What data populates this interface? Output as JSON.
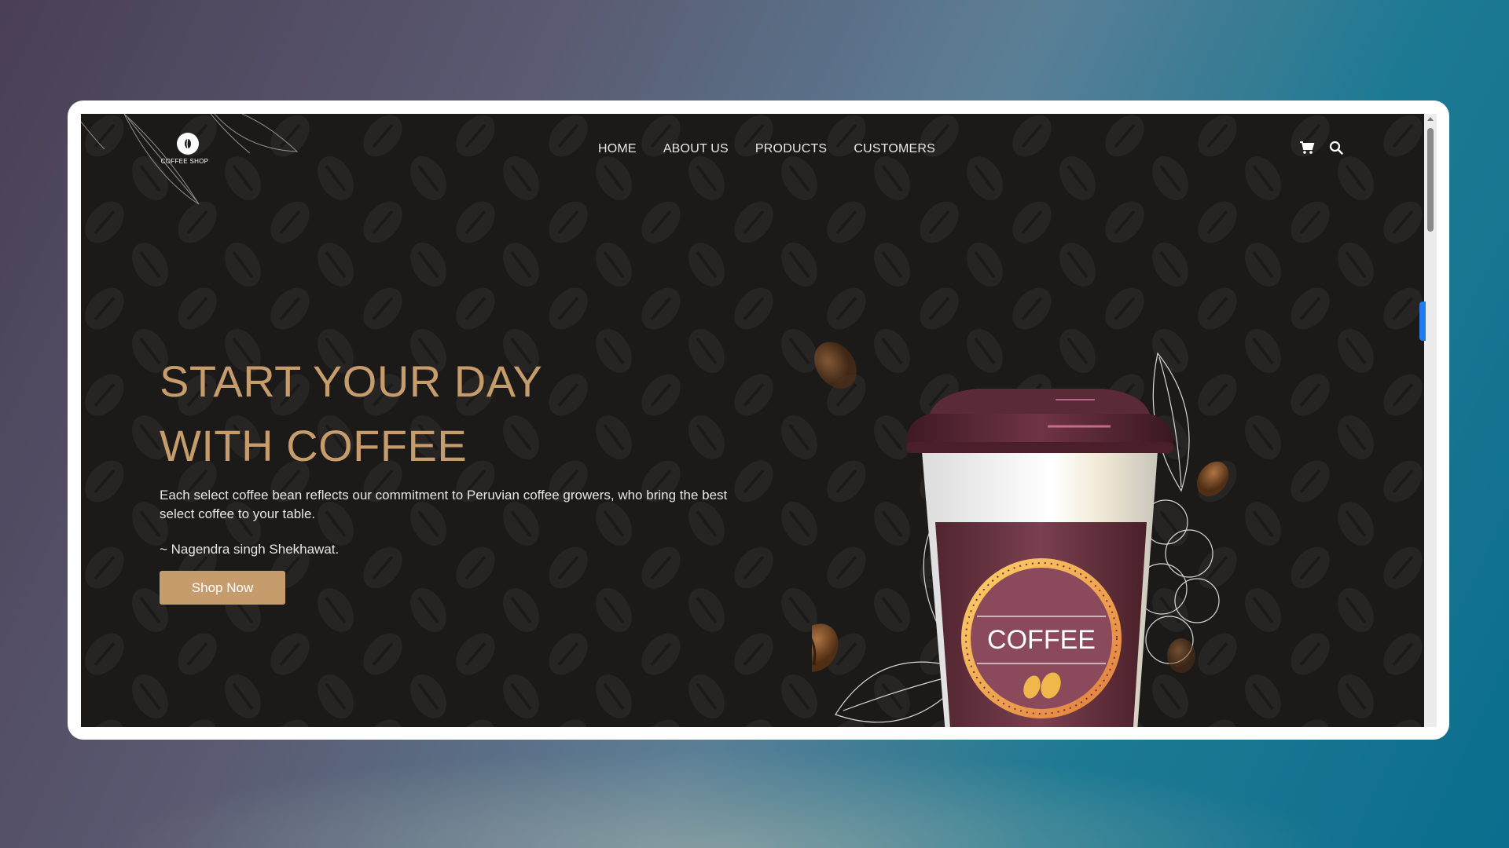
{
  "brand": {
    "name": "COFFEE SHOP"
  },
  "nav": {
    "items": [
      {
        "label": "HOME"
      },
      {
        "label": "ABOUT US"
      },
      {
        "label": "PRODUCTS"
      },
      {
        "label": "CUSTOMERS"
      }
    ],
    "icons": [
      "cart-icon",
      "search-icon"
    ]
  },
  "hero": {
    "title_line1": "START YOUR DAY",
    "title_line2": "WITH COFFEE",
    "description": "Each select coffee bean reflects our commitment to Peruvian coffee growers, who bring the best select coffee to your table.",
    "author": "~ Nagendra singh Shekhawat.",
    "button_label": "Shop Now"
  },
  "cup": {
    "label": "COFFEE"
  },
  "colors": {
    "accent": "#c69c6d",
    "page_bg": "#1b1a19",
    "cup_sleeve": "#6b3546",
    "scroll_indicator": "#1e7bf0"
  }
}
